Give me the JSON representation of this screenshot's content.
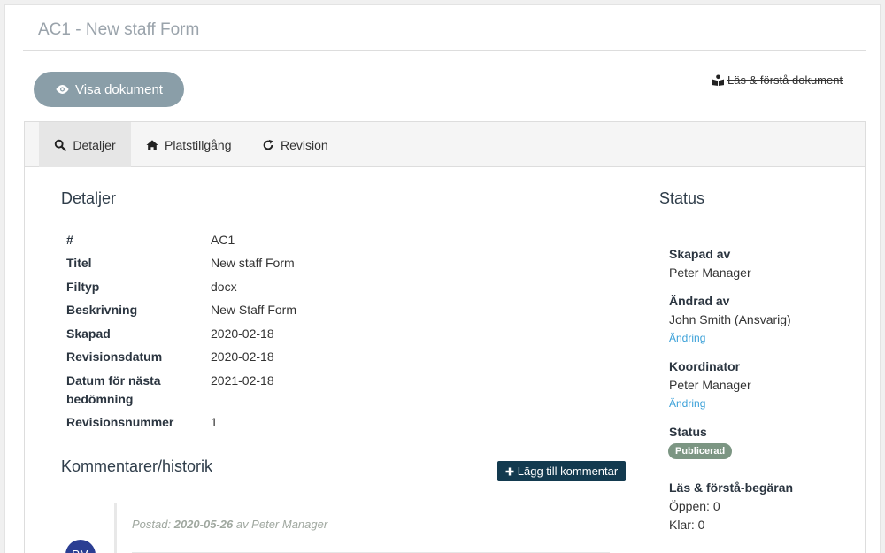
{
  "header": {
    "title": "AC1 - New staff Form"
  },
  "actions": {
    "visa_label": "Visa dokument",
    "las_label": "Läs & förstå dokument"
  },
  "tabs": [
    {
      "label": "Detaljer",
      "icon": "search-icon",
      "active": true
    },
    {
      "label": "Platstillgång",
      "icon": "home-icon",
      "active": false
    },
    {
      "label": "Revision",
      "icon": "refresh-icon",
      "active": false
    }
  ],
  "details": {
    "title": "Detaljer",
    "rows": [
      {
        "label": "#",
        "value": "AC1"
      },
      {
        "label": "Titel",
        "value": "New staff Form"
      },
      {
        "label": "Filtyp",
        "value": "docx"
      },
      {
        "label": "Beskrivning",
        "value": "New Staff Form"
      },
      {
        "label": "Skapad",
        "value": "2020-02-18"
      },
      {
        "label": "Revisionsdatum",
        "value": "2020-02-18"
      },
      {
        "label": "Datum för nästa bedömning",
        "value": "2021-02-18"
      },
      {
        "label": "Revisionsnummer",
        "value": "1"
      }
    ]
  },
  "comments": {
    "title": "Kommentarer/historik",
    "add_label": "Lägg till kommentar",
    "posted_prefix": "Postad:",
    "posted_date": "2020-05-26",
    "posted_by": "av Peter Manager",
    "avatar_initials": "PM"
  },
  "status": {
    "title": "Status",
    "skapad_label": "Skapad av",
    "skapad_value": "Peter Manager",
    "andrad_label": "Ändrad av",
    "andrad_value": "John Smith (Ansvarig)",
    "andrad_link": "Ändring",
    "koord_label": "Koordinator",
    "koord_value": "Peter Manager",
    "koord_link": "Ändring",
    "status_label": "Status",
    "status_badge": "Publicerad",
    "las_label": "Läs & förstå-begäran",
    "oppen": "Öppen: 0",
    "klar": "Klar: 0"
  },
  "colors": {
    "visa_button": "#8a9ea8",
    "add_button": "#133a4f",
    "badge": "#7c9683",
    "link": "#3aa0d8",
    "avatar": "#2b3e93"
  }
}
